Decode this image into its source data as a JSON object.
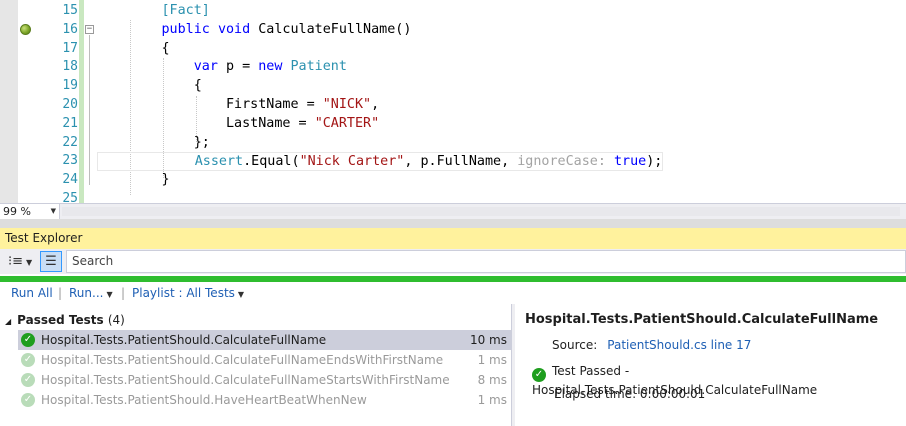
{
  "editor": {
    "line_numbers": [
      "15",
      "16",
      "17",
      "18",
      "19",
      "20",
      "21",
      "22",
      "23",
      "24",
      "25"
    ],
    "code": {
      "l15": "[Fact]",
      "l16_kw1": "public",
      "l16_kw2": "void",
      "l16_name": "CalculateFullName()",
      "l17": "{",
      "l18_kw": "var",
      "l18_mid": " p = ",
      "l18_kw2": "new",
      "l18_type": "Patient",
      "l19": "{",
      "l20_prop": "FirstName = ",
      "l20_str": "\"NICK\"",
      "l20_end": ",",
      "l21_prop": "LastName = ",
      "l21_str": "\"CARTER\"",
      "l22": "};",
      "l23_type": "Assert",
      "l23_a": ".Equal(",
      "l23_str": "\"Nick Carter\"",
      "l23_b": ", p.FullName, ",
      "l23_hint": "ignoreCase:",
      "l23_kw": "true",
      "l23_end": ");",
      "l24": "}"
    },
    "zoom": "99 %"
  },
  "test_explorer": {
    "title": "Test Explorer",
    "search_placeholder": "Search",
    "actions": {
      "run_all": "Run All",
      "run": "Run...",
      "playlist": "Playlist : All Tests"
    },
    "group": {
      "label": "Passed Tests",
      "count": "(4)"
    },
    "tests": [
      {
        "name": "Hospital.Tests.PatientShould.CalculateFullName",
        "duration": "10 ms"
      },
      {
        "name": "Hospital.Tests.PatientShould.CalculateFullNameEndsWithFirstName",
        "duration": "1 ms"
      },
      {
        "name": "Hospital.Tests.PatientShould.CalculateFullNameStartsWithFirstName",
        "duration": "8 ms"
      },
      {
        "name": "Hospital.Tests.PatientShould.HaveHeartBeatWhenNew",
        "duration": "1 ms"
      }
    ],
    "detail": {
      "title": "Hospital.Tests.PatientShould.CalculateFullName",
      "source_label": "Source:",
      "source_link": "PatientShould.cs line 17",
      "status": "Test Passed - Hospital.Tests.PatientShould.CalculateFullName",
      "elapsed": "Elapsed time: 0:00:00.01"
    }
  },
  "colors": {
    "passed": "#1e9e1e",
    "header_yellow": "#fff29d",
    "progress_green": "#2fbd2f",
    "keyword": "#0000ff",
    "type": "#2b91af",
    "string": "#a31515"
  }
}
